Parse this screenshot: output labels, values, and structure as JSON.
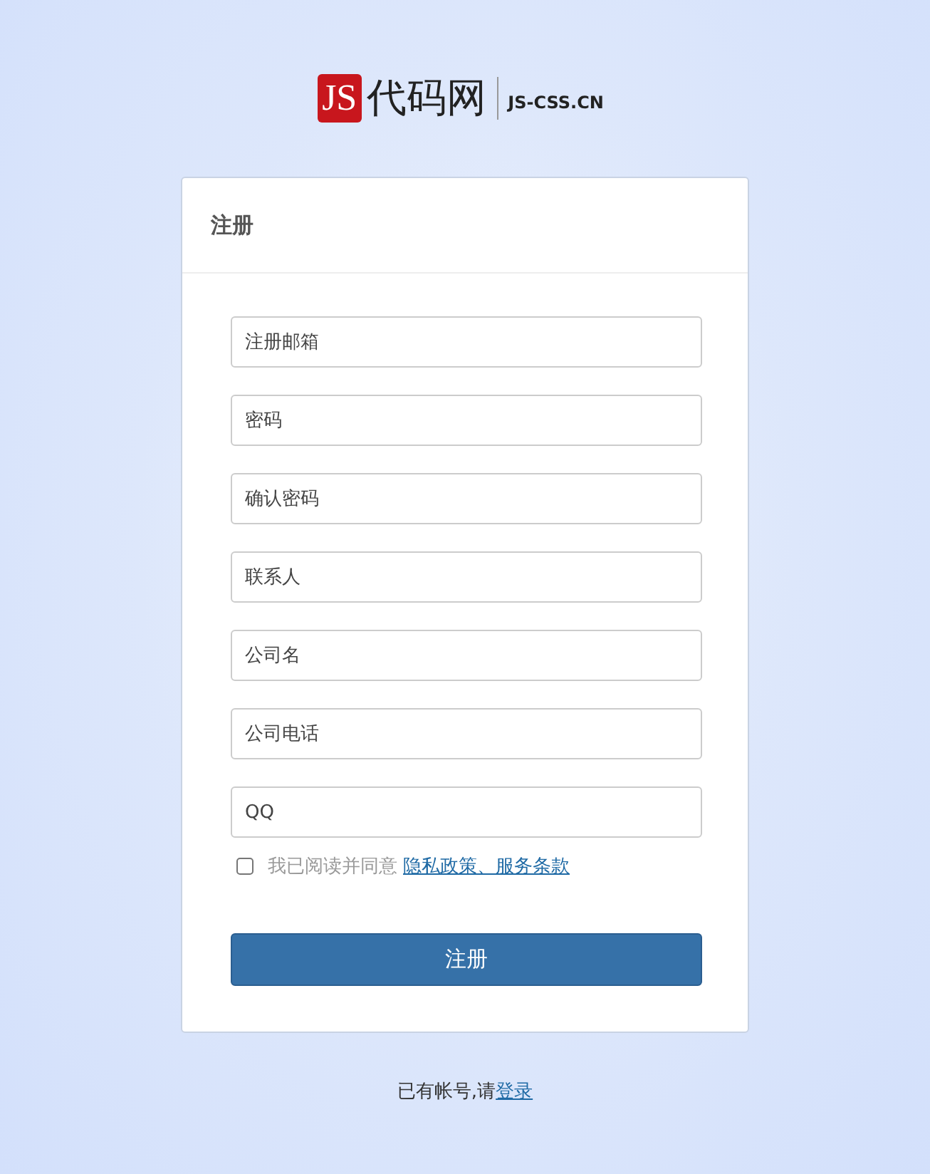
{
  "logo": {
    "badge": "JS",
    "name": "代码网",
    "domain": "JS-CSS.CN"
  },
  "form": {
    "title": "注册",
    "fields": [
      {
        "placeholder": "注册邮箱"
      },
      {
        "placeholder": "密码"
      },
      {
        "placeholder": "确认密码"
      },
      {
        "placeholder": "联系人"
      },
      {
        "placeholder": "公司名"
      },
      {
        "placeholder": "公司电话"
      },
      {
        "placeholder": "QQ"
      }
    ],
    "agree": {
      "checked": false,
      "text": "我已阅读并同意",
      "link": "隐私政策、服务条款"
    },
    "submit": "注册"
  },
  "footer": {
    "text": "已有帐号,请",
    "link": "登录"
  }
}
